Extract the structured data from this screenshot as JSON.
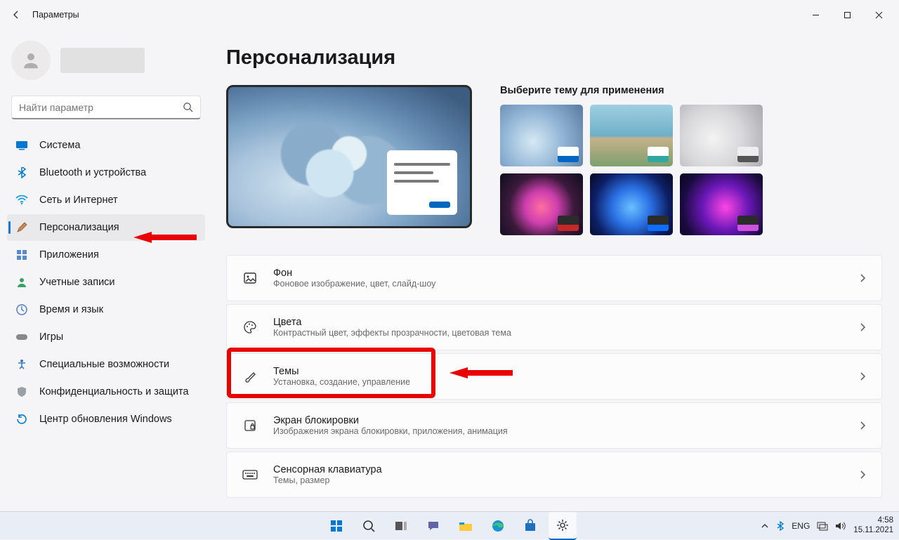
{
  "window": {
    "title": "Параметры",
    "minimize": "Свернуть",
    "maximize": "Развернуть",
    "close": "Закрыть"
  },
  "user": {
    "name": ""
  },
  "search": {
    "placeholder": "Найти параметр"
  },
  "nav": {
    "system": "Система",
    "bluetooth": "Bluetooth и устройства",
    "network": "Сеть и Интернет",
    "personalization": "Персонализация",
    "apps": "Приложения",
    "accounts": "Учетные записи",
    "time": "Время и язык",
    "gaming": "Игры",
    "accessibility": "Специальные возможности",
    "privacy": "Конфиденциальность и защита",
    "update": "Центр обновления Windows"
  },
  "main": {
    "heading": "Персонализация",
    "chooseTheme": "Выберите тему для применения",
    "cards": {
      "background": {
        "title": "Фон",
        "sub": "Фоновое изображение, цвет, слайд-шоу"
      },
      "colors": {
        "title": "Цвета",
        "sub": "Контрастный цвет, эффекты прозрачности, цветовая тема"
      },
      "themes": {
        "title": "Темы",
        "sub": "Установка, создание, управление"
      },
      "lockscreen": {
        "title": "Экран блокировки",
        "sub": "Изображения экрана блокировки, приложения, анимация"
      },
      "touchkb": {
        "title": "Сенсорная клавиатура",
        "sub": "Темы, размер"
      }
    }
  },
  "taskbar": {
    "lang": "ENG",
    "time": "4:58",
    "date": "15.11.2021"
  }
}
